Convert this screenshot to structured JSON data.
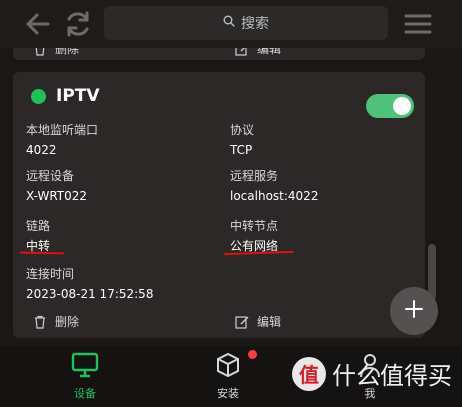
{
  "search": {
    "placeholder": "搜索"
  },
  "prev_card": {
    "delete_label": "删除",
    "edit_label": "编辑"
  },
  "card": {
    "title": "IPTV",
    "status_color": "#1fc25a",
    "enabled": true,
    "fields": {
      "local_port": {
        "label": "本地监听端口",
        "value": "4022"
      },
      "protocol": {
        "label": "协议",
        "value": "TCP"
      },
      "remote_device": {
        "label": "远程设备",
        "value": "X-WRT022"
      },
      "remote_service": {
        "label": "远程服务",
        "value": "localhost:4022"
      },
      "link": {
        "label": "链路",
        "value": "中转"
      },
      "relay_node": {
        "label": "中转节点",
        "value": "公有网络"
      },
      "connect_time": {
        "label": "连接时间",
        "value": "2023-08-21 17:52:58"
      }
    },
    "delete_label": "删除",
    "edit_label": "编辑"
  },
  "fab": {
    "icon": "plus-icon"
  },
  "nav": {
    "items": [
      {
        "label": "设备",
        "icon": "monitor-icon",
        "active": true
      },
      {
        "label": "安装",
        "icon": "package-icon",
        "badge": true
      },
      {
        "label": "我",
        "icon": "person-icon"
      }
    ]
  },
  "watermark": {
    "logo": "值",
    "text": "什么值得买"
  },
  "colors": {
    "accent": "#1fc25a",
    "annotation": "#e01010",
    "badge": "#ff3b46"
  }
}
